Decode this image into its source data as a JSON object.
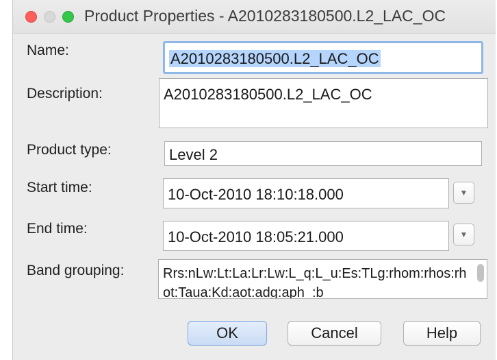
{
  "window": {
    "title": "Product Properties - A2010283180500.L2_LAC_OC"
  },
  "form": {
    "name_label": "Name:",
    "name_value": "A2010283180500.L2_LAC_OC",
    "description_label": "Description:",
    "description_value": "A2010283180500.L2_LAC_OC",
    "product_type_label": "Product type:",
    "product_type_value": "Level 2",
    "start_time_label": "Start time:",
    "start_time_value": "10-Oct-2010 18:10:18.000",
    "end_time_label": "End time:",
    "end_time_value": "10-Oct-2010 18:05:21.000",
    "band_grouping_label": "Band grouping:",
    "band_grouping_value": "Rrs:nLw:Lt:La:Lr:Lw:L_q:L_u:Es:TLg:rhom:rhos:rhot:Taua:Kd:aot:adg:aph_:b"
  },
  "buttons": {
    "ok": "OK",
    "cancel": "Cancel",
    "help": "Help"
  },
  "icons": {
    "dropdown": "chevron-down-icon",
    "close": "close-traffic-light",
    "minimize": "minimize-traffic-light",
    "maximize": "maximize-traffic-light"
  },
  "colors": {
    "selection": "#b5d5fd",
    "focus_ring": "#8fb8e8",
    "default_button": "#c9dcf5",
    "close": "#fc605c",
    "maximize": "#34c84a"
  }
}
